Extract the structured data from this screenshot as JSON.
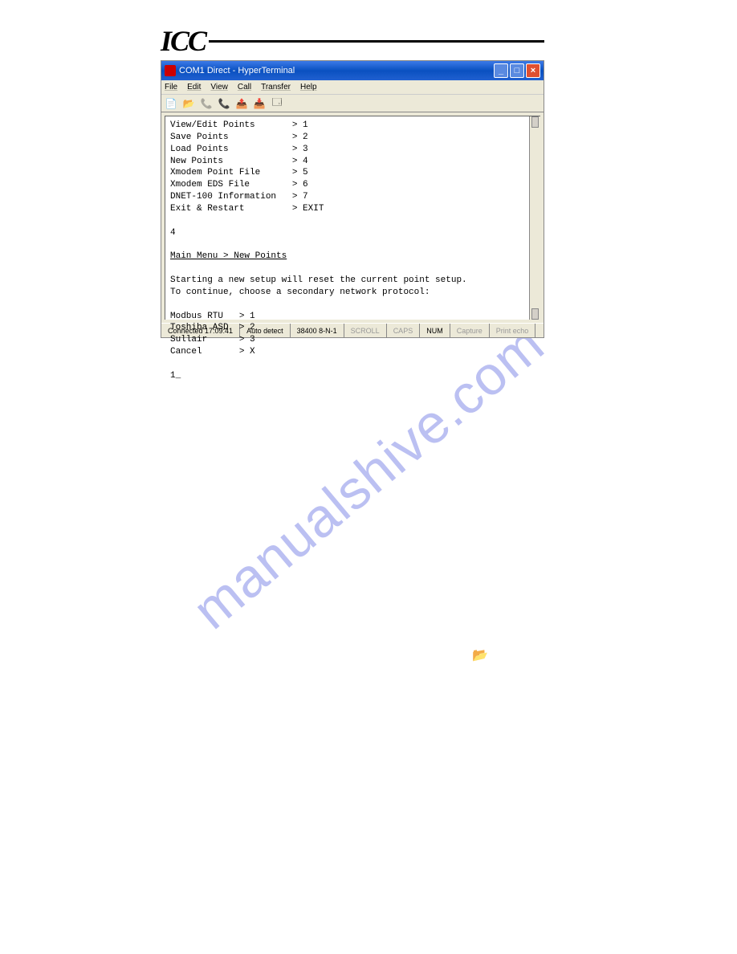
{
  "header": {
    "logo": "ICC"
  },
  "watermark": "manualshive.com",
  "window": {
    "title": "COM1 Direct - HyperTerminal",
    "menubar": [
      "File",
      "Edit",
      "View",
      "Call",
      "Transfer",
      "Help"
    ],
    "statusbar": {
      "connected": "Connected 17:09:41",
      "autodetect": "Auto detect",
      "baud": "38400 8-N-1",
      "scroll": "SCROLL",
      "caps": "CAPS",
      "num": "NUM",
      "capture": "Capture",
      "printecho": "Print echo"
    }
  },
  "terminal": {
    "menu_items": [
      {
        "label": "View/Edit Points",
        "key": "1"
      },
      {
        "label": "Save Points",
        "key": "2"
      },
      {
        "label": "Load Points",
        "key": "3"
      },
      {
        "label": "New Points",
        "key": "4"
      },
      {
        "label": "Xmodem Point File",
        "key": "5"
      },
      {
        "label": "Xmodem EDS File",
        "key": "6"
      },
      {
        "label": "DNET-100 Information",
        "key": "7"
      },
      {
        "label": "Exit & Restart",
        "key": "EXIT"
      }
    ],
    "input1": "4",
    "breadcrumb": "Main Menu > New Points",
    "message1": "Starting a new setup will reset the current point setup.",
    "message2": "To continue, choose a secondary network protocol:",
    "protocols": [
      {
        "label": "Modbus RTU",
        "key": "1"
      },
      {
        "label": "Toshiba ASD",
        "key": "2"
      },
      {
        "label": "Sullair",
        "key": "3"
      },
      {
        "label": "Cancel",
        "key": "X"
      }
    ],
    "input2": "1_"
  }
}
